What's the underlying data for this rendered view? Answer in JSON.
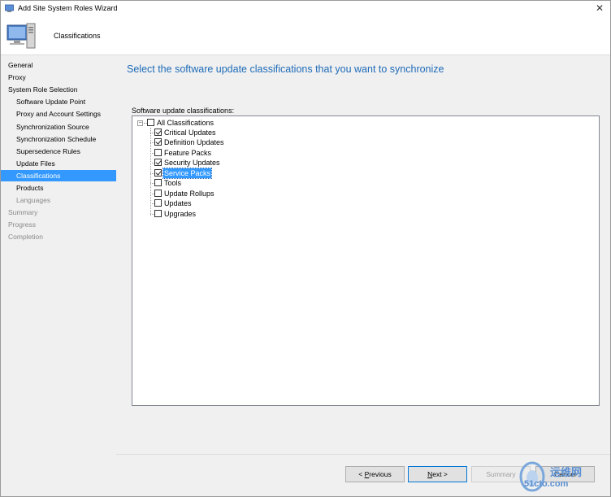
{
  "window": {
    "title": "Add Site System Roles Wizard"
  },
  "header": {
    "page_name": "Classifications"
  },
  "nav": {
    "items": [
      {
        "label": "General",
        "level": 0,
        "state": "normal"
      },
      {
        "label": "Proxy",
        "level": 0,
        "state": "normal"
      },
      {
        "label": "System Role Selection",
        "level": 0,
        "state": "normal"
      },
      {
        "label": "Software Update Point",
        "level": 1,
        "state": "normal"
      },
      {
        "label": "Proxy and Account Settings",
        "level": 1,
        "state": "normal"
      },
      {
        "label": "Synchronization Source",
        "level": 1,
        "state": "normal"
      },
      {
        "label": "Synchronization Schedule",
        "level": 1,
        "state": "normal"
      },
      {
        "label": "Supersedence Rules",
        "level": 1,
        "state": "normal"
      },
      {
        "label": "Update Files",
        "level": 1,
        "state": "normal"
      },
      {
        "label": "Classifications",
        "level": 1,
        "state": "selected"
      },
      {
        "label": "Products",
        "level": 1,
        "state": "normal"
      },
      {
        "label": "Languages",
        "level": 2,
        "state": "dim"
      },
      {
        "label": "Summary",
        "level": 0,
        "state": "dim"
      },
      {
        "label": "Progress",
        "level": 0,
        "state": "dim"
      },
      {
        "label": "Completion",
        "level": 0,
        "state": "dim"
      }
    ]
  },
  "main": {
    "heading": "Select the software update classifications that you want to synchronize",
    "list_label": "Software update classifications:",
    "root": {
      "label": "All Classifications",
      "checked": false,
      "expander": "−"
    },
    "classifications": [
      {
        "label": "Critical Updates",
        "checked": true,
        "highlighted": false
      },
      {
        "label": "Definition Updates",
        "checked": true,
        "highlighted": false
      },
      {
        "label": "Feature Packs",
        "checked": false,
        "highlighted": false
      },
      {
        "label": "Security Updates",
        "checked": true,
        "highlighted": false
      },
      {
        "label": "Service Packs",
        "checked": true,
        "highlighted": true
      },
      {
        "label": "Tools",
        "checked": false,
        "highlighted": false
      },
      {
        "label": "Update Rollups",
        "checked": false,
        "highlighted": false
      },
      {
        "label": "Updates",
        "checked": false,
        "highlighted": false
      },
      {
        "label": "Upgrades",
        "checked": false,
        "highlighted": false
      }
    ]
  },
  "buttons": {
    "previous_prefix": "< ",
    "previous_accel": "P",
    "previous_rest": "revious",
    "next_accel": "N",
    "next_rest": "ext >",
    "summary": "Summary",
    "cancel": "Cancel"
  },
  "watermark": {
    "line1": "运维网",
    "line2": "51cto.com"
  },
  "colors": {
    "accent": "#3399ff",
    "heading": "#1e6bb8",
    "panel": "#f0f0f0"
  }
}
